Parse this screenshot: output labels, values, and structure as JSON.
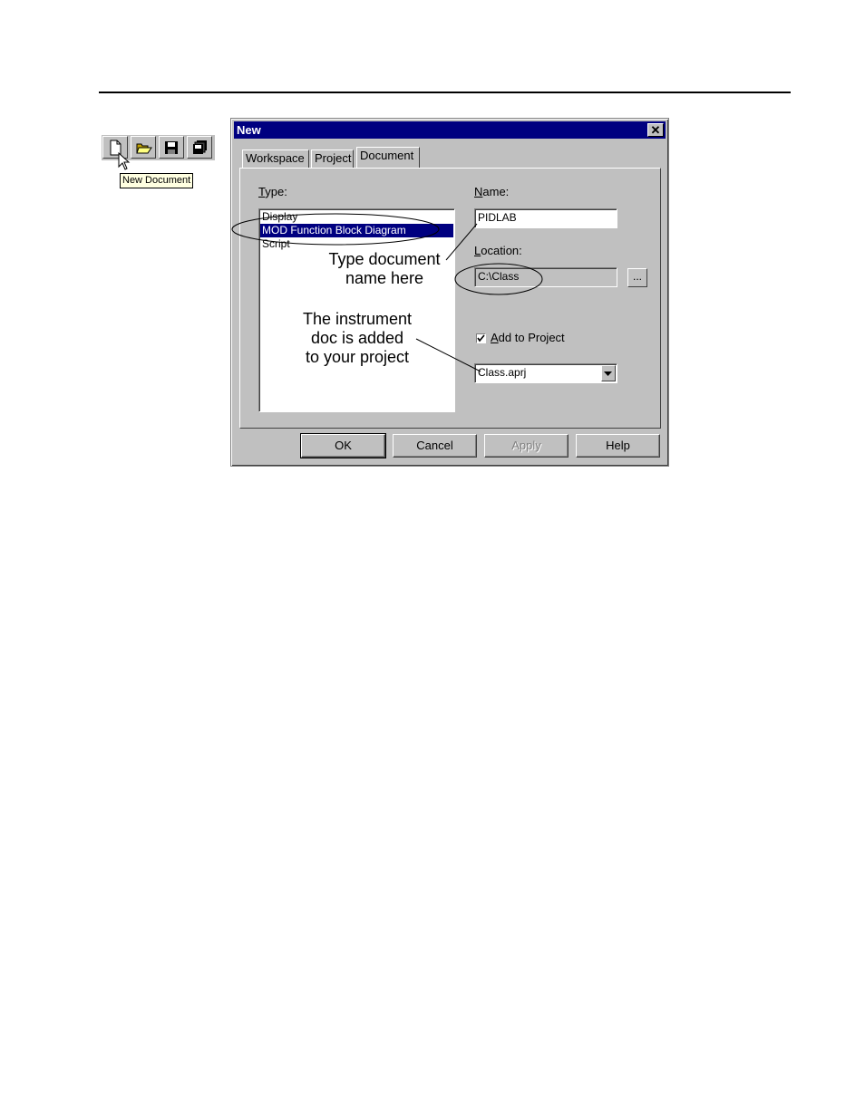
{
  "toolbar": {
    "buttons": [
      {
        "icon": "new-document-icon"
      },
      {
        "icon": "open-folder-icon"
      },
      {
        "icon": "save-disk-icon"
      },
      {
        "icon": "save-all-icon"
      }
    ],
    "tooltip": "New Document"
  },
  "dialog": {
    "title": "New",
    "tabs": [
      "Workspace",
      "Project",
      "Document"
    ],
    "active_tab": "Document",
    "type_label": "Type:",
    "type_items": [
      "Display",
      "MOD Function Block Diagram",
      "Script"
    ],
    "selected_type": "MOD Function Block Diagram",
    "name_label": "Name:",
    "name_value": "PIDLAB",
    "location_label": "Location:",
    "location_value": "C:\\Class",
    "browse_label": "...",
    "add_to_project_label": "Add to Project",
    "add_to_project_checked": true,
    "project_select_value": "Class.aprj",
    "buttons": {
      "ok": "OK",
      "cancel": "Cancel",
      "apply": "Apply",
      "help": "Help"
    }
  },
  "annotations": {
    "type_name_line1": "Type document",
    "type_name_line2": "name here",
    "instrument_line1": "The instrument",
    "instrument_line2": "doc is added",
    "instrument_line3": "to your project"
  }
}
